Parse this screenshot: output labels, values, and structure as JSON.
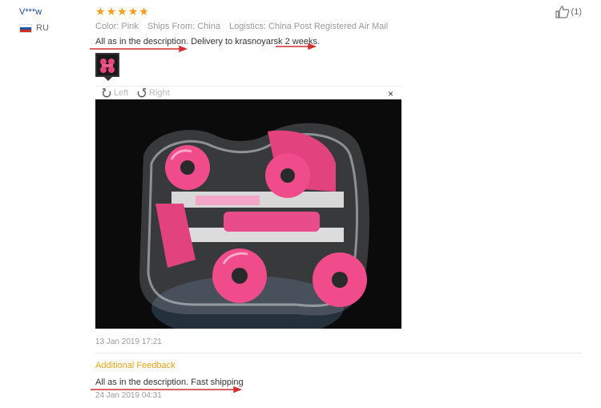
{
  "user": {
    "name": "V***w",
    "country": "RU"
  },
  "review": {
    "rating": 5,
    "color_key": "Color:",
    "color_val": "Pink",
    "ships_key": "Ships From:",
    "ships_val": "China",
    "logistics_key": "Logistics:",
    "logistics_val": "China Post Registered Air Mail",
    "text": "All as in the description. Delivery to krasnoyarsk 2 weeks.",
    "date": "13 Jan 2019 17:21"
  },
  "helpful": {
    "count": "(1)"
  },
  "viewer": {
    "left_label": "Left",
    "right_label": "Right",
    "close": "×"
  },
  "additional": {
    "heading": "Additional Feedback",
    "text": "All as in the description. Fast shipping",
    "date": "24 Jan 2019 04:31"
  },
  "colors": {
    "star": "#f79c1b",
    "accent": "#e8a317",
    "annotation": "#d32f2f"
  }
}
